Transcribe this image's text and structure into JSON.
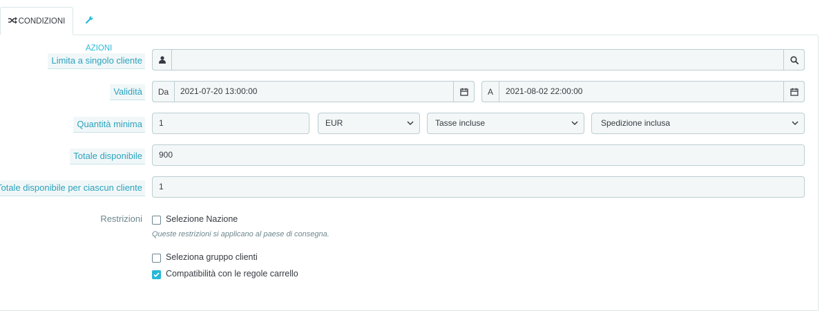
{
  "tabs": {
    "conditions": "CONDIZIONI",
    "actions": "AZIONI"
  },
  "form": {
    "single_customer": {
      "label": "Limita a singolo cliente",
      "value": ""
    },
    "validity": {
      "label": "Validità",
      "from_prefix": "Da",
      "from_value": "2021-07-20 13:00:00",
      "to_prefix": "A",
      "to_value": "2021-08-02 22:00:00"
    },
    "min_amount": {
      "label": "Quantità minima",
      "value": "1",
      "currency": "EUR",
      "tax": "Tasse incluse",
      "shipping": "Spedizione inclusa"
    },
    "total_available": {
      "label": "Totale disponibile",
      "value": "900"
    },
    "per_customer": {
      "label": "Totale disponibile per ciascun cliente",
      "value": "1"
    },
    "restrictions": {
      "label": "Restrizioni",
      "country": {
        "label": "Selezione Nazione",
        "checked": false
      },
      "country_hint": "Queste restrizioni si applicano al paese di consegna.",
      "group": {
        "label": "Seleziona gruppo clienti",
        "checked": false
      },
      "cart_rule": {
        "label": "Compatibilità con le regole carrello",
        "checked": true
      }
    }
  },
  "colors": {
    "accent": "#25b9d7",
    "label_text": "#2aa2bd",
    "input_bg": "#f4f7f7",
    "border": "#bbcdd2"
  }
}
